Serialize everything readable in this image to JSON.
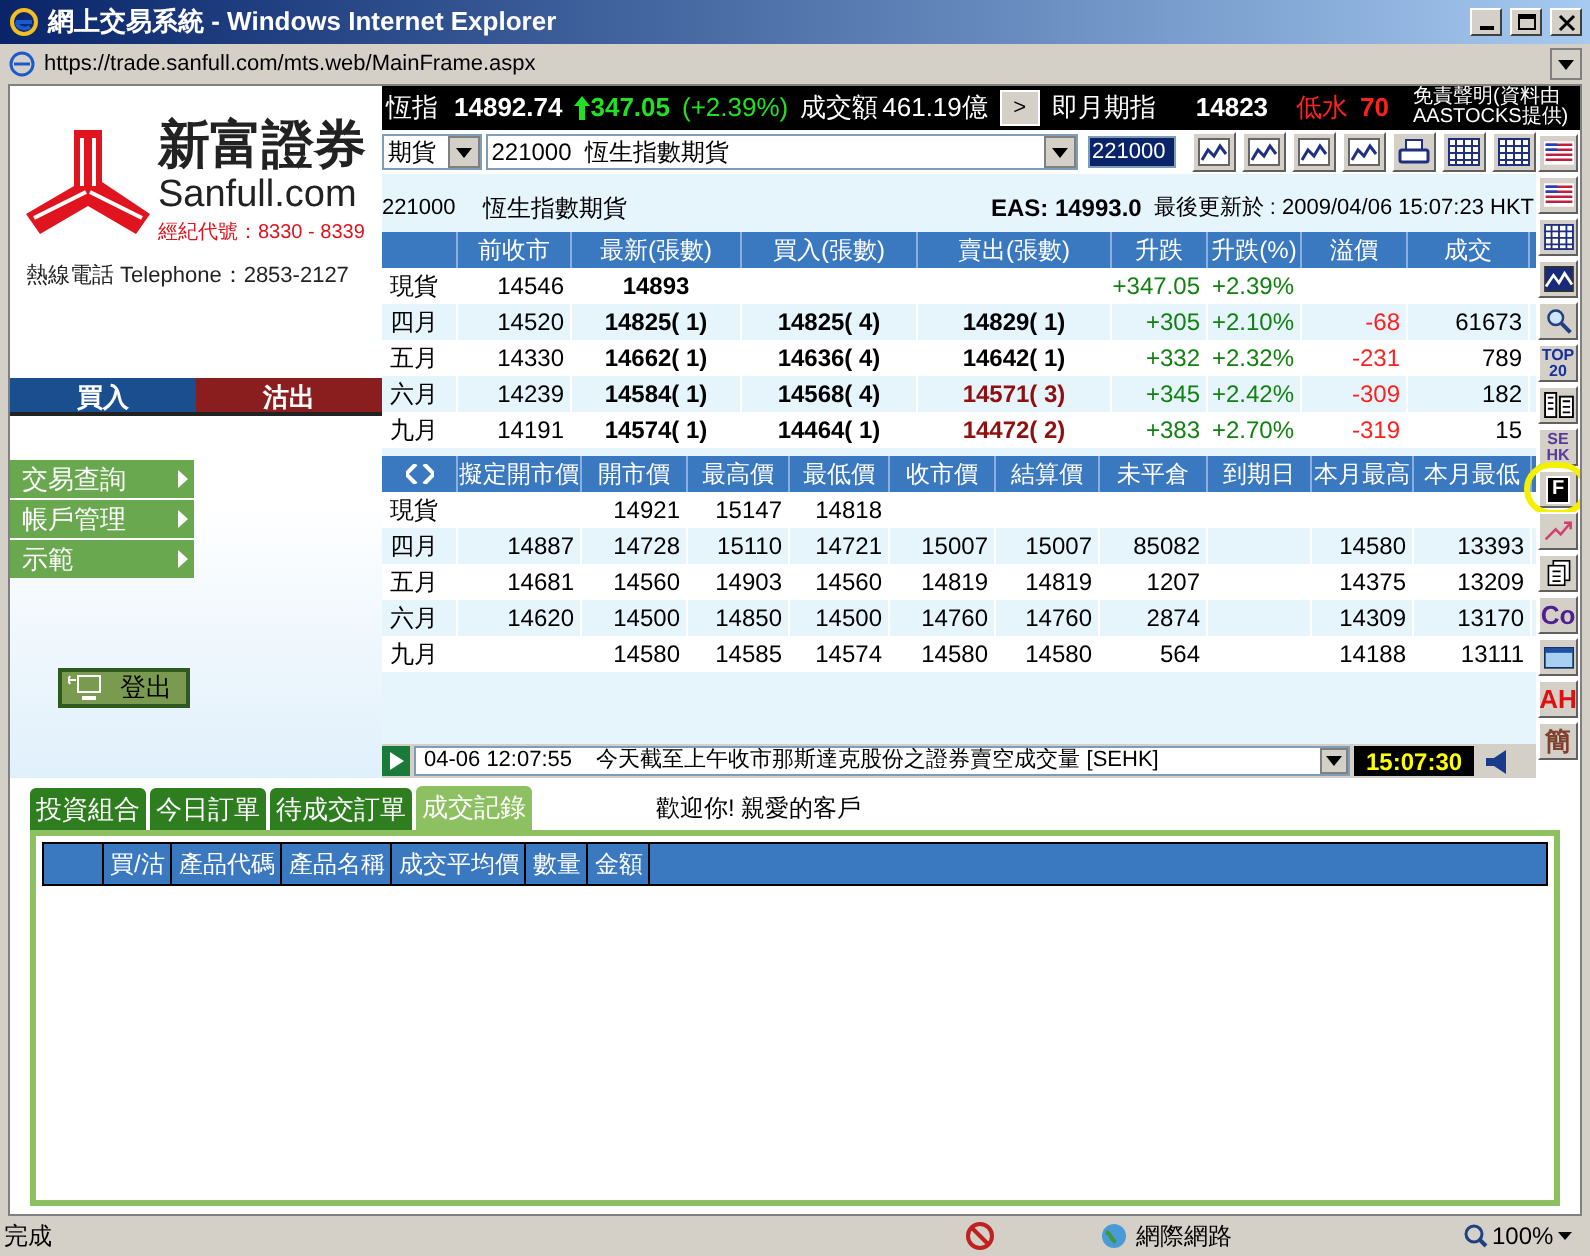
{
  "window": {
    "title": "網上交易系統 - Windows Internet Explorer",
    "address": "https://trade.sanfull.com/mts.web/MainFrame.aspx"
  },
  "brand": {
    "name": "新富證券",
    "site": "Sanfull.com",
    "broker_no": "經紀代號：8330 - 8339",
    "hotline": "熱線電話 Telephone：2853-2127"
  },
  "trade_buttons": [
    {
      "label": "買入",
      "kind": "buy"
    },
    {
      "label": "沽出",
      "kind": "sell"
    }
  ],
  "menu": [
    {
      "label": "交易查詢"
    },
    {
      "label": "帳戶管理"
    },
    {
      "label": "示範"
    }
  ],
  "logout": {
    "label": "登出"
  },
  "index_bar": {
    "name": "恆指",
    "value": "14892.74",
    "change": "347.05",
    "pct": "(+2.39%)",
    "turnover_label": "成交額",
    "turnover": "461.19億",
    "next": ">",
    "fut_label": "即月期指",
    "fut_value": "14823",
    "basis_label": "低水",
    "basis": "70",
    "disclaimer_1": "免責聲明(資料由",
    "disclaimer_2": "AASTOCKS提供)"
  },
  "selector": {
    "type": "期貨",
    "product": "221000  恆生指數期貨",
    "code": "221000"
  },
  "chart_tools": [
    {
      "kind": "line"
    },
    {
      "kind": "line"
    },
    {
      "kind": "line"
    },
    {
      "kind": "line"
    },
    {
      "kind": "printer"
    },
    {
      "kind": "grid"
    },
    {
      "kind": "grid"
    }
  ],
  "info": {
    "code": "221000",
    "name": "恆生指數期貨",
    "eas": "EAS: 14993.0",
    "updated": "最後更新於 : 2009/04/06  15:07:23 HKT"
  },
  "quotes": {
    "columns": [
      "",
      "前收市",
      "最新(張數)",
      "買入(張數)",
      "賣出(張數)",
      "升跌",
      "升跌(%)",
      "溢價",
      "成交"
    ],
    "rows": [
      {
        "cells": [
          "現貨",
          "14546",
          "14893",
          "",
          "",
          "+347.05",
          "+2.39%",
          "",
          ""
        ],
        "ask_highlight": false
      },
      {
        "cells": [
          "四月",
          "14520",
          "14825( 1)",
          "14825( 4)",
          "14829( 1)",
          "+305",
          "+2.10%",
          "-68",
          "61673"
        ],
        "ask_highlight": false
      },
      {
        "cells": [
          "五月",
          "14330",
          "14662( 1)",
          "14636( 4)",
          "14642( 1)",
          "+332",
          "+2.32%",
          "-231",
          "789"
        ],
        "ask_highlight": false
      },
      {
        "cells": [
          "六月",
          "14239",
          "14584( 1)",
          "14568( 4)",
          "14571( 3)",
          "+345",
          "+2.42%",
          "-309",
          "182"
        ],
        "ask_highlight": true
      },
      {
        "cells": [
          "九月",
          "14191",
          "14574( 1)",
          "14464( 1)",
          "14472( 2)",
          "+383",
          "+2.70%",
          "-319",
          "15"
        ],
        "ask_highlight": true
      }
    ]
  },
  "details": {
    "columns": [
      "",
      "擬定開市價",
      "開市價",
      "最高價",
      "最低價",
      "收市價",
      "結算價",
      "未平倉",
      "到期日",
      "本月最高",
      "本月最低"
    ],
    "rows": [
      [
        "現貨",
        "",
        "14921",
        "15147",
        "14818",
        "",
        "",
        "",
        "",
        "",
        ""
      ],
      [
        "四月",
        "14887",
        "14728",
        "15110",
        "14721",
        "15007",
        "15007",
        "85082",
        "",
        "14580",
        "13393"
      ],
      [
        "五月",
        "14681",
        "14560",
        "14903",
        "14560",
        "14819",
        "14819",
        "1207",
        "",
        "14375",
        "13209"
      ],
      [
        "六月",
        "14620",
        "14500",
        "14850",
        "14500",
        "14760",
        "14760",
        "2874",
        "",
        "14309",
        "13170"
      ],
      [
        "九月",
        "",
        "14580",
        "14585",
        "14574",
        "14580",
        "14580",
        "564",
        "",
        "14188",
        "13111"
      ]
    ]
  },
  "news_ticker": {
    "text": "04-06 12:07:55    今天截至上午收市那斯達克股份之證券賣空成交量 [SEHK]",
    "time": "15:07:30"
  },
  "side_tools": [
    {
      "kind": "news",
      "highlighted": false
    },
    {
      "kind": "news",
      "highlighted": false
    },
    {
      "kind": "grid",
      "highlighted": false
    },
    {
      "kind": "mountain",
      "highlighted": false
    },
    {
      "kind": "search",
      "highlighted": false
    },
    {
      "kind": "label",
      "text": "TOP\n20",
      "color": "#1830a0",
      "highlighted": false
    },
    {
      "kind": "list",
      "highlighted": false
    },
    {
      "kind": "label",
      "text": "SE\nHK",
      "color": "#5a3a9a",
      "highlighted": false
    },
    {
      "kind": "label",
      "text": "F",
      "color": "#000000",
      "highlighted": true
    },
    {
      "kind": "trend",
      "highlighted": false
    },
    {
      "kind": "doc",
      "highlighted": false
    },
    {
      "kind": "label",
      "text": "Co",
      "color": "#502090",
      "highlighted": false
    },
    {
      "kind": "folder",
      "highlighted": false
    },
    {
      "kind": "label",
      "text": "AH",
      "color": "#e01010",
      "highlighted": false
    },
    {
      "kind": "label",
      "text": "簡",
      "color": "#804030",
      "highlighted": false
    }
  ],
  "tabs": [
    {
      "label": "投資組合",
      "selected": false
    },
    {
      "label": "今日訂單",
      "selected": false
    },
    {
      "label": "待成交訂單",
      "selected": false
    },
    {
      "label": "成交記錄",
      "selected": true
    }
  ],
  "welcome": "歡迎你! 親愛的客戶",
  "records": {
    "columns": [
      "",
      "買/沽",
      "產品代碼",
      "產品名稱",
      "成交平均價",
      "數量",
      "金額"
    ]
  },
  "status_bar": {
    "text": "完成",
    "zone": "網際網路",
    "zoom": "100%"
  }
}
